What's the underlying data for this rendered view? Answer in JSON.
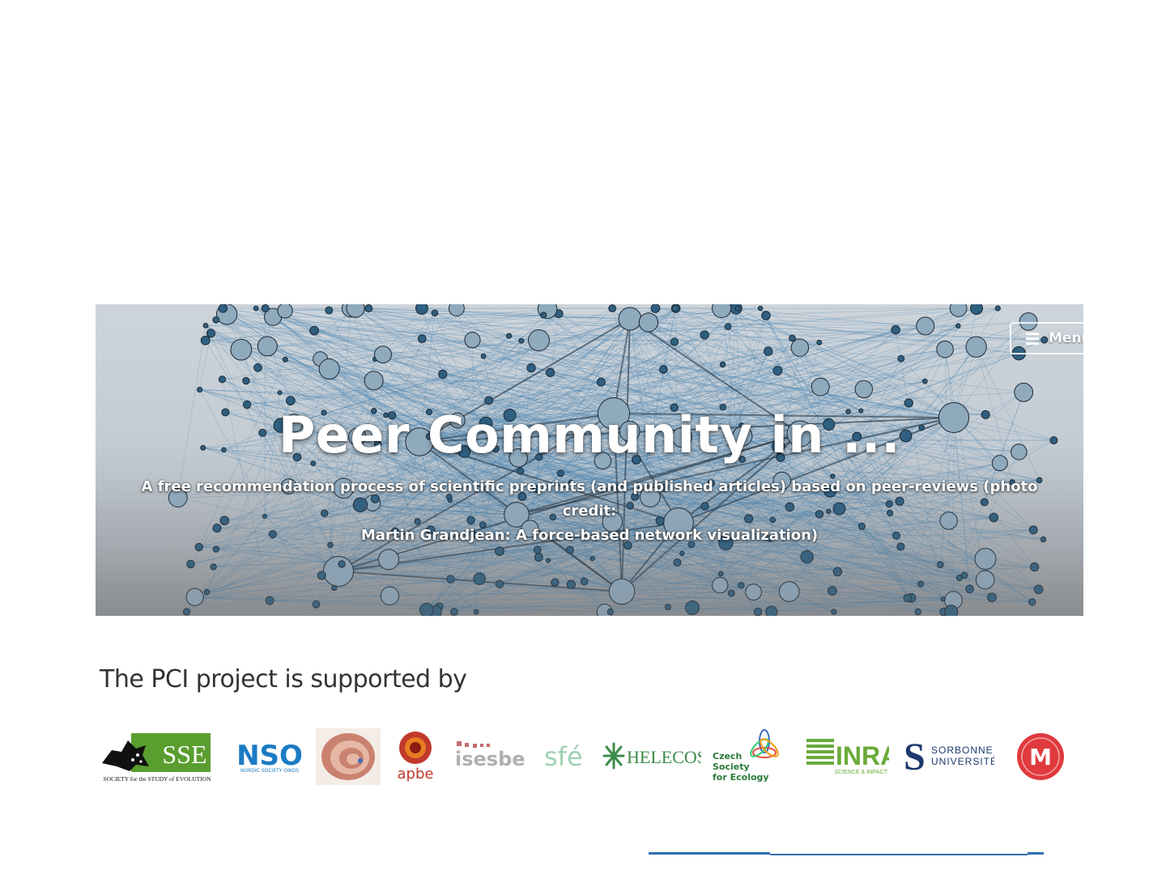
{
  "hero": {
    "menu_label": "Menu",
    "title": "Peer Community in ...",
    "subtitle_line1": "A free recommendation process of scientific preprints (and published articles) based on peer-reviews (photo credit:",
    "subtitle_line2": "Martin Grandjean: A force-based network visualization)"
  },
  "supporters": {
    "heading": "The PCI project is supported by",
    "logos": [
      {
        "name": "SSE",
        "text": "SSE",
        "caption": "SOCIETY for the STUDY of EVOLUTION"
      },
      {
        "name": "NSO",
        "text": "NSO",
        "caption": "NORDIC SOCIETY OIKOS"
      },
      {
        "name": "nautilus-logo"
      },
      {
        "name": "apbe",
        "text": "apbe"
      },
      {
        "name": "isesbe",
        "text": "isesbe"
      },
      {
        "name": "sfe",
        "text": "sfé"
      },
      {
        "name": "HELECOS",
        "text": "HELECOS"
      },
      {
        "name": "Czech Society for Ecology",
        "line1": "Czech",
        "line2": "Society",
        "line3": "for Ecology"
      },
      {
        "name": "INRA",
        "text": "INRA",
        "caption": "SCIENCE & IMPACT"
      },
      {
        "name": "Sorbonne Université",
        "line1": "SORBONNE",
        "line2": "UNIVERSITÉ"
      },
      {
        "name": "Université de Montpellier",
        "text": "M"
      }
    ]
  },
  "colors": {
    "network_edge": "#3f7fae",
    "network_node": "#2f5f80",
    "network_node_light": "#8fa9bd",
    "sse_green": "#5a9e2f",
    "nso_blue": "#1a7bc4",
    "inra_green": "#6aaa3a",
    "sorbonne_blue": "#1d3a6e",
    "montpellier_red": "#e03a3e",
    "footer_line": "#2f6fae"
  }
}
